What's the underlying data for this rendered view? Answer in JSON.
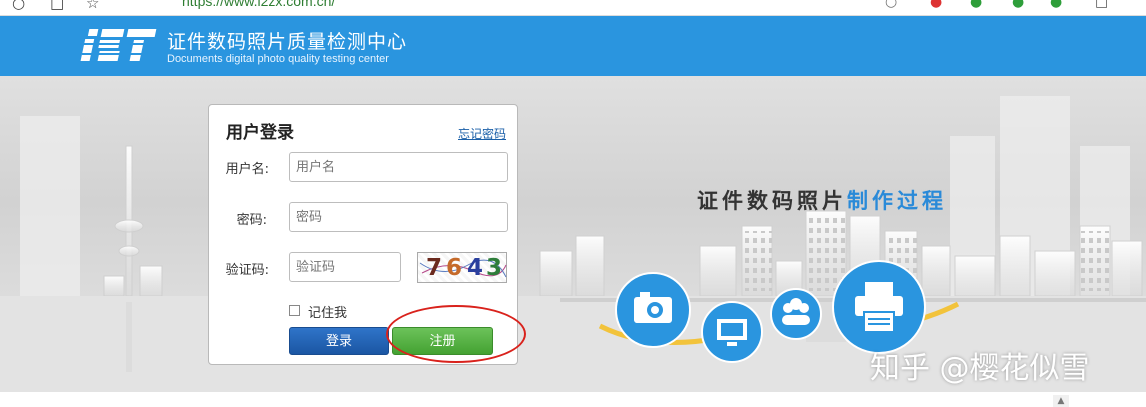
{
  "browser": {
    "url": "https://www.i2zx.com.cn/"
  },
  "header": {
    "logo_text": "iST",
    "title_cn": "证件数码照片质量检测中心",
    "title_en": "Documents digital photo quality testing center",
    "bg_color": "#2a95df"
  },
  "login": {
    "title": "用户登录",
    "forgot_link": "忘记密码",
    "username_label": "用户名:",
    "username_placeholder": "用户名",
    "password_label": "密码:",
    "password_placeholder": "密码",
    "captcha_label": "验证码:",
    "captcha_placeholder": "验证码",
    "captcha_digits": [
      "7",
      "6",
      "4",
      "3"
    ],
    "remember_label": "记住我",
    "login_button": "登录",
    "register_button": "注册"
  },
  "banner": {
    "slogan_dark": "证件数码照片",
    "slogan_blue": "制作过程",
    "icons": [
      "camera-icon",
      "monitor-icon",
      "users-icon",
      "printer-icon"
    ]
  },
  "watermark": "知乎 @樱花似雪",
  "colors": {
    "accent_blue": "#2a95df",
    "login_blue": "#1b56a3",
    "register_green": "#44a232",
    "annotation_red": "#d9221c"
  }
}
